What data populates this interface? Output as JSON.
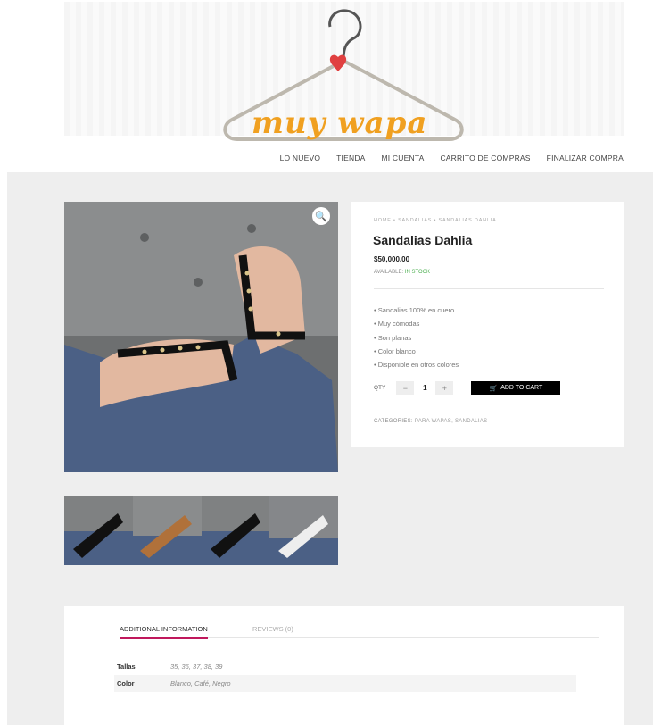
{
  "brand": {
    "name": "muy wapa"
  },
  "nav": [
    "LO NUEVO",
    "TIENDA",
    "MI CUENTA",
    "CARRITO DE COMPRAS",
    "FINALIZAR COMPRA"
  ],
  "product": {
    "breadcrumb": "HOME • SANDALIAS • SANDALIAS DAHLIA",
    "title": "Sandalias Dahlia",
    "price": "$50,000.00",
    "availability_label": "AVAILABLE:",
    "availability_value": "IN STOCK",
    "features": [
      "Sandalias 100% en cuero",
      "Muy cómodas",
      "Son planas",
      "Color blanco",
      "Disponible en otros colores"
    ],
    "qty_label": "QTY",
    "qty_value": "1",
    "add_to_cart": "ADD TO CART",
    "categories_label": "CATEGORIES:",
    "categories": "PARA WAPAS, SANDALIAS"
  },
  "tabs": [
    {
      "label": "ADDITIONAL INFORMATION",
      "active": true
    },
    {
      "label": "REVIEWS (0)",
      "active": false
    }
  ],
  "attributes": [
    {
      "name": "Tallas",
      "value": "35, 36, 37, 38, 39"
    },
    {
      "name": "Color",
      "value": "Blanco, Café, Negro"
    }
  ],
  "colors": {
    "accent": "#c0185c",
    "logo": "#f0a020",
    "stock": "#4caf50",
    "background": "#eeeeee"
  }
}
